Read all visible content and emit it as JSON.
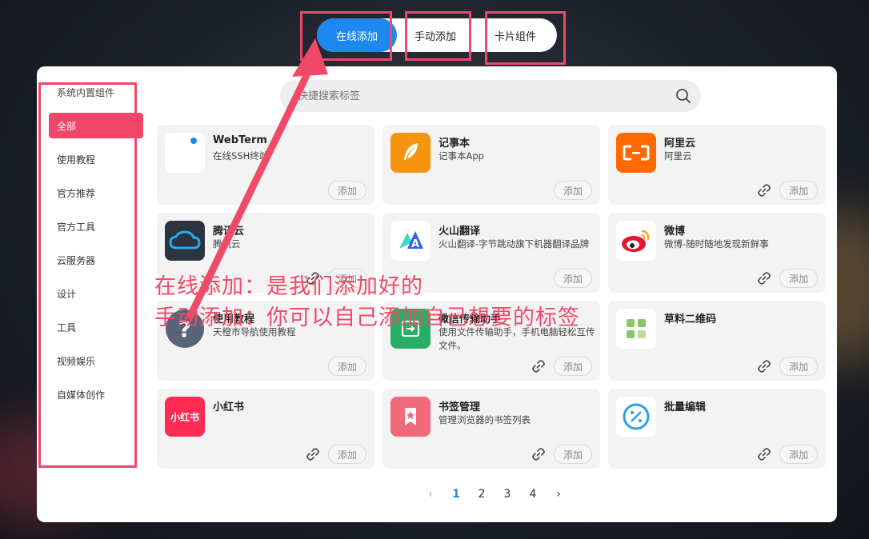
{
  "tabs": [
    {
      "label": "在线添加"
    },
    {
      "label": "手动添加"
    },
    {
      "label": "卡片组件"
    }
  ],
  "sidebar": {
    "title": "系统内置组件",
    "items": [
      {
        "label": "全部"
      },
      {
        "label": "使用教程"
      },
      {
        "label": "官方推荐"
      },
      {
        "label": "官方工具"
      },
      {
        "label": "云服务器"
      },
      {
        "label": "设计"
      },
      {
        "label": "工具"
      },
      {
        "label": "视频娱乐"
      },
      {
        "label": "自媒体创作"
      }
    ]
  },
  "search": {
    "placeholder": "快捷搜索标签"
  },
  "add_label": "添加",
  "cards": [
    {
      "name": "WebTerm",
      "desc": "在线SSH终端",
      "logo_text": "",
      "logo_color": "#ffffff",
      "has_link": false
    },
    {
      "name": "记事本",
      "desc": "记事本App",
      "logo_text": "",
      "logo_color": "#f7940f",
      "has_link": false
    },
    {
      "name": "阿里云",
      "desc": "阿里云",
      "logo_text": "",
      "logo_color": "#ff6a00",
      "has_link": true
    },
    {
      "name": "腾讯云",
      "desc": "腾讯云",
      "logo_text": "",
      "logo_color": "#2b3440",
      "has_link": true
    },
    {
      "name": "火山翻译",
      "desc": "火山翻译-字节跳动旗下机器翻译品牌",
      "logo_text": "",
      "logo_color": "#ffffff",
      "has_link": false
    },
    {
      "name": "微博",
      "desc": "微博-随时随地发现新鲜事",
      "logo_text": "",
      "logo_color": "#ffffff",
      "has_link": true
    },
    {
      "name": "使用教程",
      "desc": "天橙市导航使用教程",
      "logo_text": "",
      "logo_color": "#5a6478",
      "has_link": false
    },
    {
      "name": "微信传输助手",
      "desc": "使用文件传输助手，手机电脑轻松互传文件。",
      "logo_text": "",
      "logo_color": "#2aae67",
      "has_link": true
    },
    {
      "name": "草料二维码",
      "desc": "",
      "logo_text": "",
      "logo_color": "#ffffff",
      "has_link": true
    },
    {
      "name": "小红书",
      "desc": "",
      "logo_text": "小红书",
      "logo_color": "#fe2c55",
      "has_link": true
    },
    {
      "name": "书签管理",
      "desc": "管理浏览器的书签列表",
      "logo_text": "",
      "logo_color": "#f06a7a",
      "has_link": true
    },
    {
      "name": "批量编辑",
      "desc": "",
      "logo_text": "",
      "logo_color": "#ffffff",
      "has_link": true
    }
  ],
  "pagination": {
    "prev": "‹",
    "pages": [
      "1",
      "2",
      "3",
      "4"
    ],
    "current": "1",
    "next": "›"
  },
  "annotations": {
    "line1": "在线添加：是我们添加好的",
    "line2": "手动添加：你可以自己添加自己想要的标签"
  },
  "colors": {
    "accent": "#1e88f0",
    "sidebar_active": "#f0466a",
    "annotation": "#f04a68"
  }
}
